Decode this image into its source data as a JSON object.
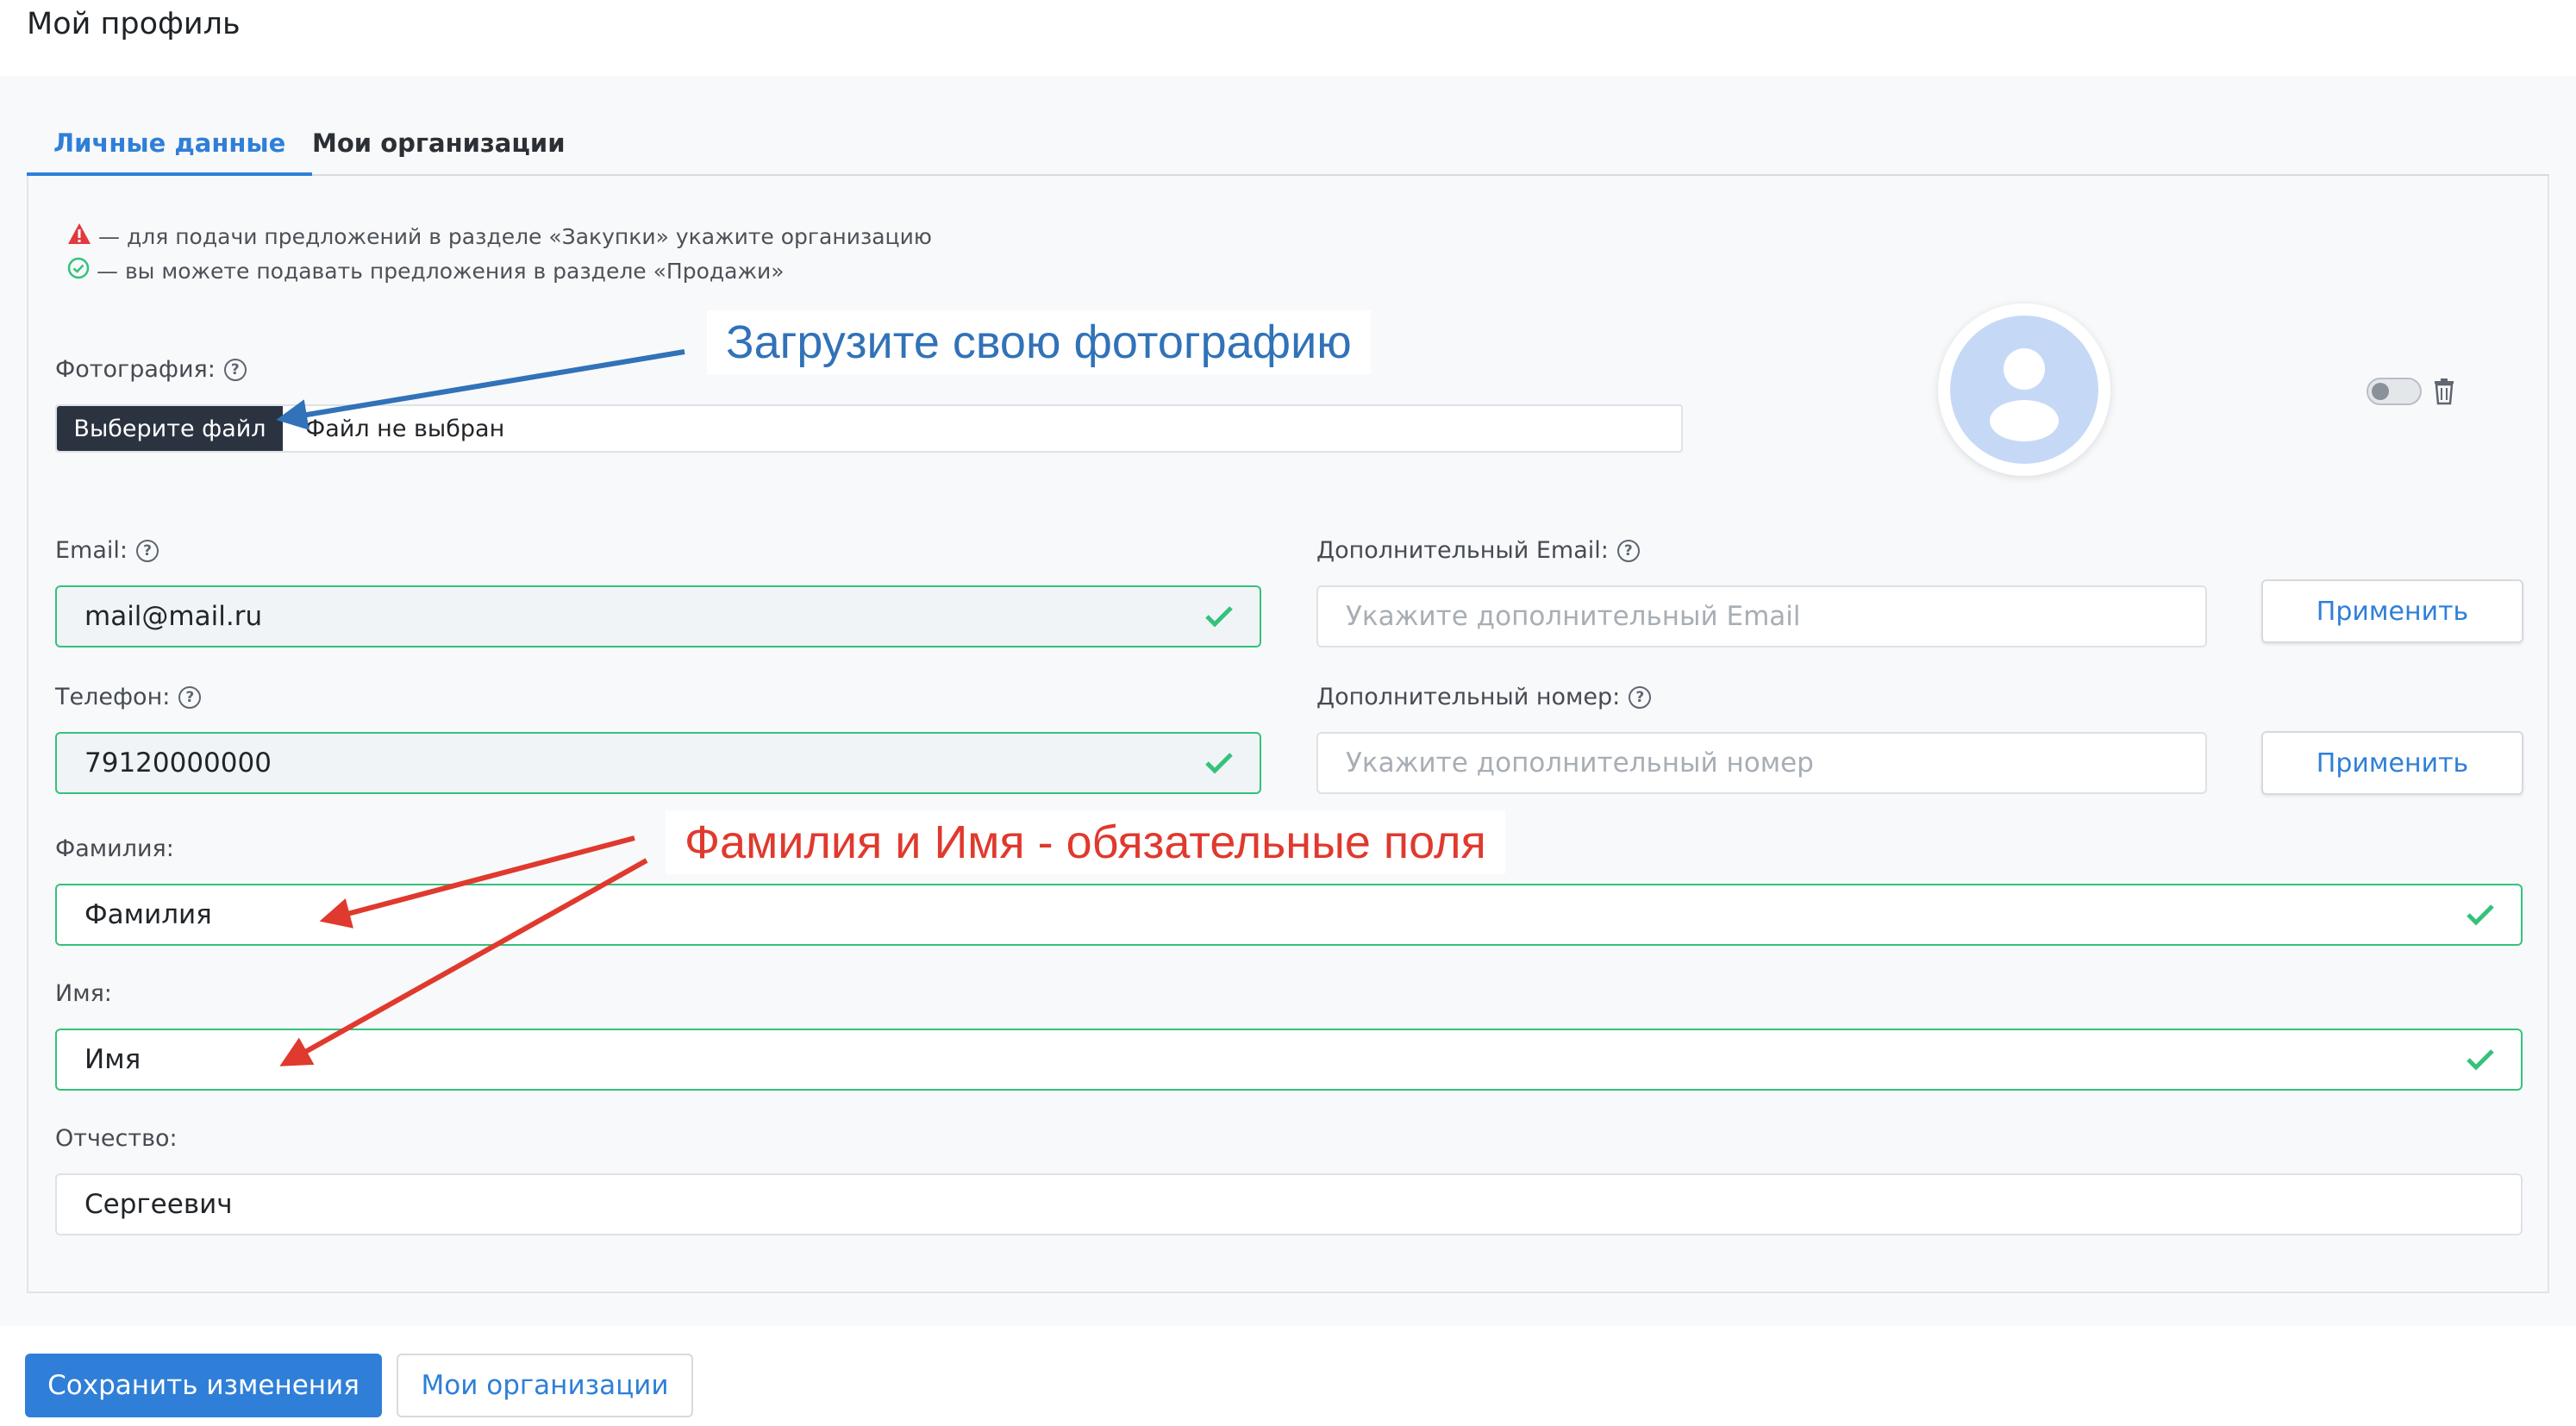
{
  "page": {
    "title": "Мой профиль"
  },
  "tabs": [
    {
      "label": "Личные данные",
      "active": true
    },
    {
      "label": "Мои организации",
      "active": false
    }
  ],
  "legend": {
    "warning_text": "— для подачи предложений в разделе «Закупки» укажите организацию",
    "ok_text": "— вы можете подавать предложения в разделе «Продажи»"
  },
  "photo": {
    "label": "Фотография:",
    "button_label": "Выберите файл",
    "file_status": "Файл не выбран"
  },
  "email": {
    "label": "Email:",
    "value": "mail@mail.ru"
  },
  "extra_email": {
    "label": "Дополнительный Email:",
    "placeholder": "Укажите дополнительный Email",
    "apply_label": "Применить"
  },
  "phone": {
    "label": "Телефон:",
    "value": "79120000000"
  },
  "extra_phone": {
    "label": "Дополнительный номер:",
    "placeholder": "Укажите дополнительный номер",
    "apply_label": "Применить"
  },
  "last_name": {
    "label": "Фамилия:",
    "value": "Фамилия"
  },
  "first_name": {
    "label": "Имя:",
    "value": "Имя"
  },
  "middle_name": {
    "label": "Отчество:",
    "value": "Сергеевич"
  },
  "actions": {
    "save_label": "Сохранить изменения",
    "orgs_label": "Мои организации"
  },
  "annotations": {
    "photo_hint": "Загрузите свою фотографию",
    "required_hint": "Фамилия и Имя - обязательные поля"
  },
  "colors": {
    "accent": "#2f7fd8",
    "valid": "#34c27b",
    "warning": "#e0393e",
    "annotation_blue": "#3172b8",
    "annotation_red": "#e0392e"
  }
}
